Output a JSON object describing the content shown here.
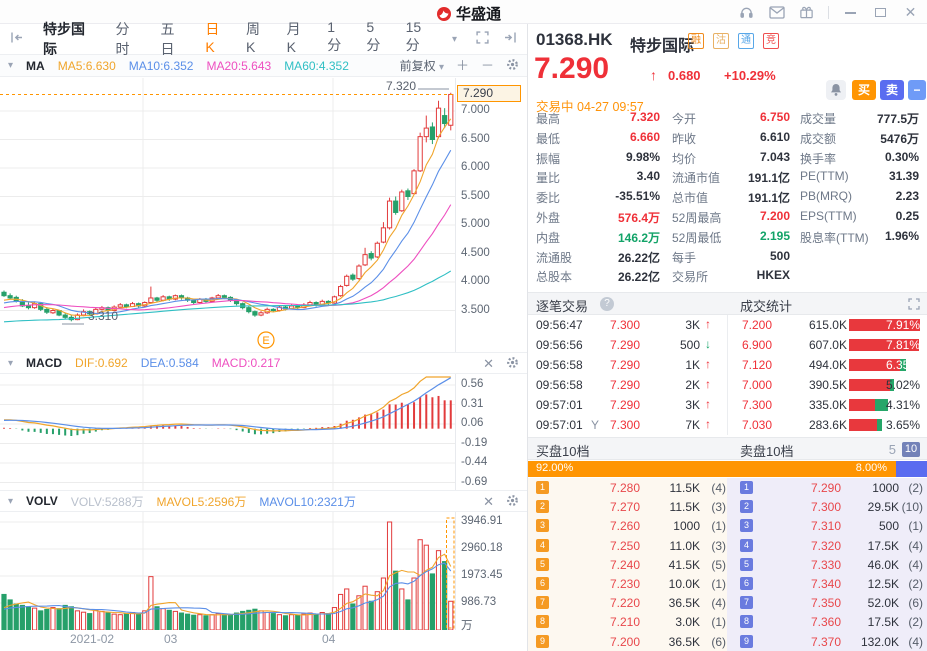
{
  "titlebar": {
    "app_name": "华盛通"
  },
  "icons": {
    "help": "?",
    "caret": "▾",
    "close_x": "✕",
    "plus": "＋",
    "minus": "－",
    "arrow_up": "↑",
    "arrow_down": "↓"
  },
  "tabbar": {
    "stock_name": "特步国际",
    "tabs": [
      "分时",
      "五日",
      "日K",
      "周K",
      "月K",
      "1分",
      "5分",
      "15分"
    ],
    "active_tab": "日K"
  },
  "ma_bar": {
    "title": "MA",
    "ma5": "MA5:6.630",
    "ma10": "MA10:6.352",
    "ma20": "MA20:5.643",
    "ma60": "MA60:4.352",
    "adjust": "前复权"
  },
  "macd_bar": {
    "title": "MACD",
    "dif": "DIF:0.692",
    "dea": "DEA:0.584",
    "macd": "MACD:0.217"
  },
  "vol_bar": {
    "title": "VOLV",
    "volv": "VOLV:5288万",
    "mavol5": "MAVOL5:2596万",
    "mavol10": "MAVOL10:2321万"
  },
  "quote": {
    "code": "01368.HK",
    "name": "特步国际",
    "badges": [
      "融",
      "沽",
      "通",
      "竞"
    ],
    "price": "7.290",
    "change": "0.680",
    "change_pct": "+10.29%",
    "status": "交易中",
    "datetime": "04-27 09:57",
    "buy_label": "买",
    "sell_label": "卖",
    "minus_label": "−",
    "stats": [
      [
        {
          "l": "最高",
          "v": "7.320",
          "c": "red"
        },
        {
          "l": "今开",
          "v": "6.750",
          "c": "red"
        },
        {
          "l": "成交量",
          "v": "777.5万",
          "c": "dark"
        }
      ],
      [
        {
          "l": "最低",
          "v": "6.660",
          "c": "red"
        },
        {
          "l": "昨收",
          "v": "6.610",
          "c": "dark"
        },
        {
          "l": "成交额",
          "v": "5476万",
          "c": "dark"
        }
      ],
      [
        {
          "l": "振幅",
          "v": "9.98%",
          "c": "dark"
        },
        {
          "l": "均价",
          "v": "7.043",
          "c": "dark"
        },
        {
          "l": "换手率",
          "v": "0.30%",
          "c": "dark"
        }
      ],
      [
        {
          "l": "量比",
          "v": "3.40",
          "c": "dark"
        },
        {
          "l": "流通市值",
          "v": "191.1亿",
          "c": "dark"
        },
        {
          "l": "PE(TTM)",
          "v": "31.39",
          "c": "dark"
        }
      ],
      [
        {
          "l": "委比",
          "v": "-35.51%",
          "c": "dark"
        },
        {
          "l": "总市值",
          "v": "191.1亿",
          "c": "dark"
        },
        {
          "l": "PB(MRQ)",
          "v": "2.23",
          "c": "dark"
        }
      ],
      [
        {
          "l": "外盘",
          "v": "576.4万",
          "c": "red"
        },
        {
          "l": "52周最高",
          "v": "7.200",
          "c": "red"
        },
        {
          "l": "EPS(TTM)",
          "v": "0.25",
          "c": "dark"
        }
      ],
      [
        {
          "l": "内盘",
          "v": "146.2万",
          "c": "green"
        },
        {
          "l": "52周最低",
          "v": "2.195",
          "c": "green"
        },
        {
          "l": "股息率(TTM)",
          "v": "1.96%",
          "c": "dark"
        }
      ],
      [
        {
          "l": "流通股",
          "v": "26.22亿",
          "c": "dark"
        },
        {
          "l": "每手",
          "v": "500",
          "c": "dark"
        }
      ],
      [
        {
          "l": "总股本",
          "v": "26.22亿",
          "c": "dark"
        },
        {
          "l": "交易所",
          "v": "HKEX",
          "c": "dark"
        }
      ]
    ]
  },
  "tick": {
    "title": "逐笔交易",
    "rows": [
      {
        "time": "09:56:47",
        "suffix": "",
        "price": "7.300",
        "vol": "3K",
        "dir": "up"
      },
      {
        "time": "09:56:56",
        "suffix": "",
        "price": "7.290",
        "vol": "500",
        "dir": "down"
      },
      {
        "time": "09:56:58",
        "suffix": "",
        "price": "7.290",
        "vol": "1K",
        "dir": "up"
      },
      {
        "time": "09:56:58",
        "suffix": "",
        "price": "7.290",
        "vol": "2K",
        "dir": "up"
      },
      {
        "time": "09:57:01",
        "suffix": "",
        "price": "7.290",
        "vol": "3K",
        "dir": "up"
      },
      {
        "time": "09:57:01",
        "suffix": "Y",
        "price": "7.300",
        "vol": "7K",
        "dir": "up"
      }
    ]
  },
  "trade_stats": {
    "title": "成交统计",
    "rows": [
      {
        "price": "7.200",
        "vol": "615.0K",
        "pct": "7.91%",
        "bar": 71,
        "green": 0,
        "white": true
      },
      {
        "price": "6.900",
        "vol": "607.0K",
        "pct": "7.81%",
        "bar": 70,
        "green": 0,
        "white": true
      },
      {
        "price": "7.120",
        "vol": "494.0K",
        "pct": "6.35%",
        "bar": 57,
        "green": 6,
        "white": true
      },
      {
        "price": "7.000",
        "vol": "390.5K",
        "pct": "5.02%",
        "bar": 45,
        "green": 4,
        "white": false
      },
      {
        "price": "7.300",
        "vol": "335.0K",
        "pct": "4.31%",
        "bar": 39,
        "green": 13,
        "white": false
      },
      {
        "price": "7.030",
        "vol": "283.6K",
        "pct": "3.65%",
        "bar": 33,
        "green": 5,
        "white": false
      }
    ]
  },
  "depth": {
    "bid_title": "买盘10档",
    "ask_title": "卖盘10档",
    "toggle_5": "5",
    "toggle_10": "10",
    "bid_pct": "92.00%",
    "ask_pct": "8.00%",
    "bid_ratio": 0.92,
    "bids": [
      {
        "n": "1",
        "p": "7.280",
        "s": "11.5K",
        "c": "(4)"
      },
      {
        "n": "2",
        "p": "7.270",
        "s": "11.5K",
        "c": "(3)"
      },
      {
        "n": "3",
        "p": "7.260",
        "s": "1000",
        "c": "(1)"
      },
      {
        "n": "4",
        "p": "7.250",
        "s": "11.0K",
        "c": "(3)"
      },
      {
        "n": "5",
        "p": "7.240",
        "s": "41.5K",
        "c": "(5)"
      },
      {
        "n": "6",
        "p": "7.230",
        "s": "10.0K",
        "c": "(1)"
      },
      {
        "n": "7",
        "p": "7.220",
        "s": "36.5K",
        "c": "(4)"
      },
      {
        "n": "8",
        "p": "7.210",
        "s": "3.0K",
        "c": "(1)"
      },
      {
        "n": "9",
        "p": "7.200",
        "s": "36.5K",
        "c": "(6)"
      }
    ],
    "asks": [
      {
        "n": "1",
        "p": "7.290",
        "s": "1000",
        "c": "(2)"
      },
      {
        "n": "2",
        "p": "7.300",
        "s": "29.5K",
        "c": "(10)"
      },
      {
        "n": "3",
        "p": "7.310",
        "s": "500",
        "c": "(1)"
      },
      {
        "n": "4",
        "p": "7.320",
        "s": "17.5K",
        "c": "(4)"
      },
      {
        "n": "5",
        "p": "7.330",
        "s": "46.0K",
        "c": "(4)"
      },
      {
        "n": "6",
        "p": "7.340",
        "s": "12.5K",
        "c": "(2)"
      },
      {
        "n": "7",
        "p": "7.350",
        "s": "52.0K",
        "c": "(6)"
      },
      {
        "n": "8",
        "p": "7.360",
        "s": "17.5K",
        "c": "(2)"
      },
      {
        "n": "9",
        "p": "7.370",
        "s": "132.0K",
        "c": "(4)"
      }
    ]
  },
  "chart_data": {
    "type": "candlestick",
    "symbol": "01368.HK",
    "interval": "daily",
    "x_axis_labels": [
      "2021-02",
      "03",
      "04"
    ],
    "price_axis": [
      7.0,
      6.5,
      6.0,
      5.5,
      5.0,
      4.5,
      4.0,
      3.5
    ],
    "current_price": 7.29,
    "annotated_high_label": "7.320",
    "annotated_low_label": "3.310",
    "event_label": "E",
    "macd_axis": [
      0.56,
      0.31,
      0.06,
      -0.19,
      -0.44,
      -0.69
    ],
    "volume_axis_wan": [
      3946.91,
      2960.18,
      1973.45,
      986.73
    ],
    "volume_axis_unit": "万",
    "overlays": {
      "ma5": 6.63,
      "ma10": 6.352,
      "ma20": 5.643,
      "ma60": 4.352
    },
    "macd_values": {
      "dif": 0.692,
      "dea": 0.584,
      "macd": 0.217
    },
    "vol_values": {
      "volv_wan": 5288,
      "mavol5_wan": 2596,
      "mavol10_wan": 2321
    },
    "ohlc": [
      [
        3.82,
        3.85,
        3.74,
        3.76
      ],
      [
        3.76,
        3.8,
        3.7,
        3.72
      ],
      [
        3.73,
        3.76,
        3.64,
        3.66
      ],
      [
        3.66,
        3.7,
        3.56,
        3.58
      ],
      [
        3.58,
        3.64,
        3.52,
        3.55
      ],
      [
        3.55,
        3.66,
        3.53,
        3.62
      ],
      [
        3.62,
        3.63,
        3.49,
        3.52
      ],
      [
        3.52,
        3.56,
        3.44,
        3.47
      ],
      [
        3.46,
        3.53,
        3.44,
        3.5
      ],
      [
        3.5,
        3.51,
        3.4,
        3.42
      ],
      [
        3.42,
        3.46,
        3.35,
        3.38
      ],
      [
        3.38,
        3.42,
        3.31,
        3.34
      ],
      [
        3.34,
        3.45,
        3.33,
        3.42
      ],
      [
        3.42,
        3.52,
        3.4,
        3.48
      ],
      [
        3.48,
        3.5,
        3.41,
        3.44
      ],
      [
        3.44,
        3.55,
        3.43,
        3.52
      ],
      [
        3.52,
        3.58,
        3.5,
        3.55
      ],
      [
        3.55,
        3.57,
        3.47,
        3.5
      ],
      [
        3.5,
        3.59,
        3.49,
        3.56
      ],
      [
        3.56,
        3.63,
        3.54,
        3.6
      ],
      [
        3.6,
        3.62,
        3.54,
        3.57
      ],
      [
        3.57,
        3.65,
        3.56,
        3.62
      ],
      [
        3.62,
        3.64,
        3.55,
        3.58
      ],
      [
        3.58,
        3.66,
        3.56,
        3.64
      ],
      [
        3.64,
        3.92,
        3.62,
        3.72
      ],
      [
        3.72,
        3.74,
        3.64,
        3.68
      ],
      [
        3.68,
        3.77,
        3.66,
        3.74
      ],
      [
        3.74,
        3.76,
        3.67,
        3.7
      ],
      [
        3.7,
        3.78,
        3.68,
        3.76
      ],
      [
        3.76,
        3.78,
        3.69,
        3.72
      ],
      [
        3.72,
        3.74,
        3.65,
        3.68
      ],
      [
        3.68,
        3.7,
        3.61,
        3.64
      ],
      [
        3.64,
        3.72,
        3.62,
        3.7
      ],
      [
        3.7,
        3.72,
        3.63,
        3.66
      ],
      [
        3.66,
        3.74,
        3.64,
        3.72
      ],
      [
        3.72,
        3.79,
        3.7,
        3.76
      ],
      [
        3.76,
        3.78,
        3.7,
        3.73
      ],
      [
        3.73,
        3.75,
        3.65,
        3.68
      ],
      [
        3.68,
        3.7,
        3.59,
        3.62
      ],
      [
        3.62,
        3.64,
        3.52,
        3.55
      ],
      [
        3.55,
        3.57,
        3.45,
        3.48
      ],
      [
        3.48,
        3.5,
        3.39,
        3.42
      ],
      [
        3.42,
        3.49,
        3.4,
        3.46
      ],
      [
        3.46,
        3.55,
        3.44,
        3.52
      ],
      [
        3.52,
        3.54,
        3.47,
        3.5
      ],
      [
        3.5,
        3.58,
        3.48,
        3.56
      ],
      [
        3.56,
        3.58,
        3.5,
        3.53
      ],
      [
        3.53,
        3.61,
        3.52,
        3.58
      ],
      [
        3.58,
        3.6,
        3.52,
        3.55
      ],
      [
        3.55,
        3.63,
        3.54,
        3.6
      ],
      [
        3.6,
        3.67,
        3.58,
        3.64
      ],
      [
        3.64,
        3.66,
        3.57,
        3.6
      ],
      [
        3.6,
        3.69,
        3.59,
        3.66
      ],
      [
        3.66,
        3.68,
        3.6,
        3.63
      ],
      [
        3.63,
        3.76,
        3.62,
        3.74
      ],
      [
        3.76,
        3.95,
        3.74,
        3.92
      ],
      [
        3.94,
        4.13,
        3.92,
        4.1
      ],
      [
        4.12,
        4.15,
        4.02,
        4.05
      ],
      [
        4.06,
        4.31,
        4.04,
        4.28
      ],
      [
        4.3,
        4.6,
        4.28,
        4.48
      ],
      [
        4.5,
        4.54,
        4.38,
        4.42
      ],
      [
        4.44,
        4.71,
        4.42,
        4.68
      ],
      [
        4.7,
        5.05,
        4.68,
        4.95
      ],
      [
        4.95,
        5.48,
        4.92,
        5.42
      ],
      [
        5.42,
        5.5,
        5.18,
        5.22
      ],
      [
        5.25,
        5.62,
        5.23,
        5.58
      ],
      [
        5.6,
        5.64,
        5.44,
        5.5
      ],
      [
        5.55,
        5.98,
        5.53,
        5.95
      ],
      [
        5.95,
        6.62,
        5.93,
        6.55
      ],
      [
        6.55,
        6.92,
        6.45,
        6.7
      ],
      [
        6.72,
        6.8,
        6.42,
        6.5
      ],
      [
        6.55,
        7.18,
        6.52,
        7.05
      ],
      [
        6.92,
        7.05,
        6.7,
        6.78
      ],
      [
        6.75,
        7.32,
        6.66,
        7.29
      ]
    ],
    "volume_wan": [
      1300,
      1100,
      950,
      900,
      850,
      800,
      700,
      750,
      820,
      780,
      900,
      850,
      700,
      650,
      600,
      720,
      680,
      620,
      580,
      560,
      600,
      640,
      580,
      700,
      1950,
      850,
      780,
      720,
      680,
      620,
      580,
      540,
      560,
      520,
      560,
      600,
      580,
      540,
      620,
      680,
      720,
      760,
      700,
      640,
      600,
      560,
      520,
      560,
      540,
      580,
      620,
      580,
      640,
      600,
      820,
      1300,
      1500,
      950,
      1250,
      1600,
      1050,
      1400,
      1900,
      3947,
      2150,
      1500,
      1100,
      1900,
      3300,
      3100,
      2050,
      2900,
      2500,
      1050
    ]
  }
}
